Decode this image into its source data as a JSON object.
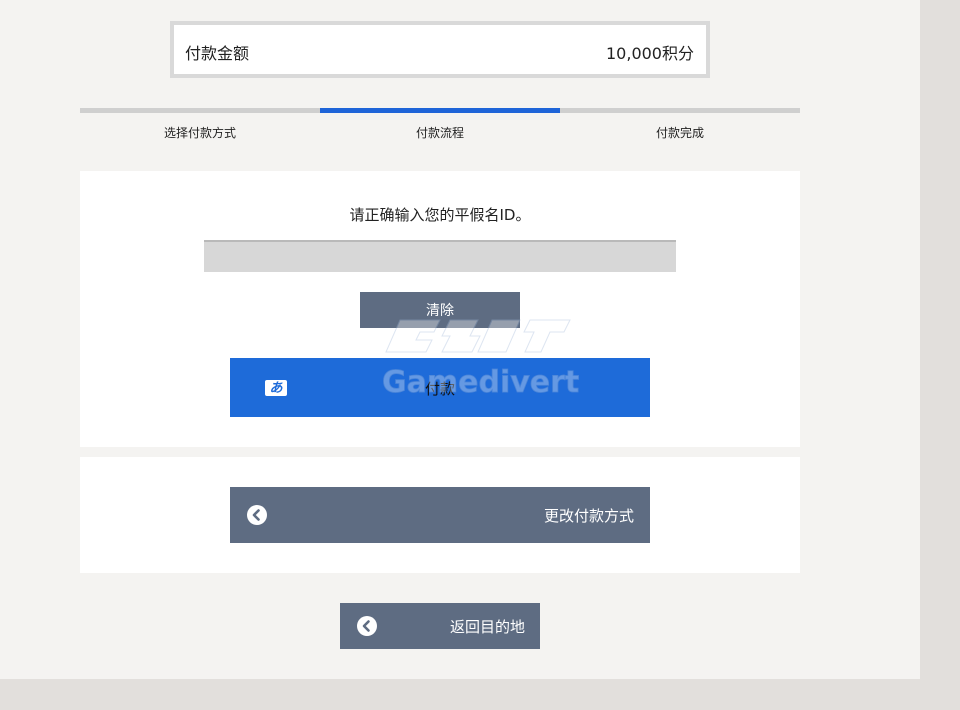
{
  "summary": {
    "label": "付款金额",
    "value": "10,000积分"
  },
  "steps": [
    {
      "label": "选择付款方式",
      "active": false
    },
    {
      "label": "付款流程",
      "active": true
    },
    {
      "label": "付款完成",
      "active": false
    }
  ],
  "form": {
    "instruction": "请正确输入您的平假名ID。",
    "input_value": "",
    "input_placeholder": "",
    "clear_label": "清除",
    "pay_label": "付款",
    "pay_icon_char": "あ"
  },
  "change_method_label": "更改付款方式",
  "back_label": "返回目的地",
  "watermark_text": "Gamedivert",
  "colors": {
    "accent": "#1e64d8",
    "button_gray": "#5e6c82",
    "page_bg": "#f4f3f1"
  }
}
